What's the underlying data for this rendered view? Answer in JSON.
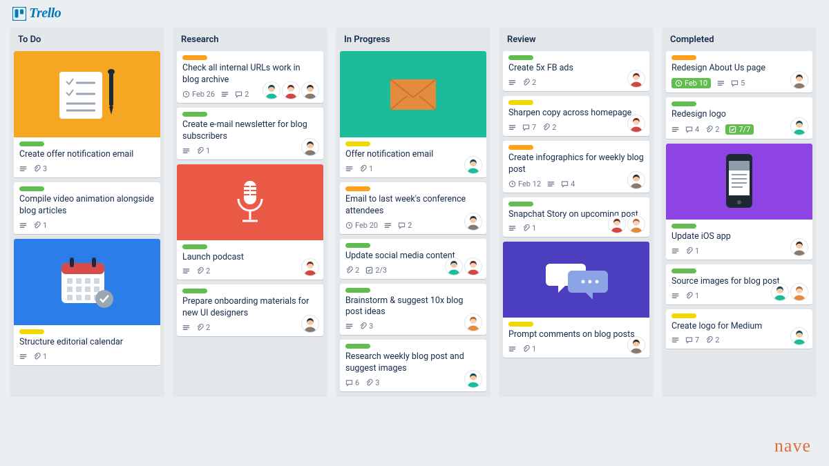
{
  "app": {
    "name": "Trello"
  },
  "brand": "nave",
  "avatars": {
    "teal": "#1abc9c",
    "brown": "#7a5c4b",
    "red": "#d0483f",
    "orange": "#e48b3e"
  },
  "icons": {
    "description": "description-icon",
    "attachment": "attachment-icon",
    "clock": "clock-icon",
    "comment": "comment-icon",
    "checklist": "checklist-icon"
  },
  "lists": [
    {
      "title": "To Do",
      "cards": [
        {
          "cover": "orange-note",
          "labels": [
            "green"
          ],
          "title": "Create offer notification email",
          "badges": {
            "description": true,
            "attachments": 3
          }
        },
        {
          "labels": [
            "green"
          ],
          "title": "Compile video animation alongside blog articles",
          "badges": {
            "description": true,
            "attachments": 1
          }
        },
        {
          "cover": "blue-calendar",
          "labels": [
            "yellow"
          ],
          "title": "Structure editorial calendar",
          "badges": {
            "description": true,
            "attachments": 1
          }
        }
      ]
    },
    {
      "title": "Research",
      "cards": [
        {
          "labels": [
            "orange"
          ],
          "title": "Check all internal URLs work in blog archive",
          "badges": {
            "due": "Feb 26",
            "description": true,
            "comments": 2
          },
          "members": [
            "teal",
            "red",
            "brown"
          ]
        },
        {
          "labels": [
            "green"
          ],
          "title": "Create e-mail newsletter for blog subscribers",
          "badges": {
            "description": true,
            "attachments": 1
          },
          "members": [
            "brown"
          ]
        },
        {
          "cover": "red-mic",
          "labels": [
            "green"
          ],
          "title": "Launch podcast",
          "badges": {
            "description": true,
            "attachments": 2
          },
          "members": [
            "red"
          ]
        },
        {
          "labels": [
            "green"
          ],
          "title": "Prepare onboarding materials for new UI designers",
          "badges": {
            "description": true,
            "attachments": 2
          },
          "members": [
            "brown"
          ]
        }
      ]
    },
    {
      "title": "In Progress",
      "cards": [
        {
          "cover": "teal-mail",
          "labels": [
            "yellow"
          ],
          "title": "Offer notification email",
          "badges": {
            "description": true,
            "attachments": 1
          },
          "members": [
            "teal"
          ]
        },
        {
          "labels": [
            "orange"
          ],
          "title": "Email to last week's conference attendees",
          "badges": {
            "due": "Feb 20",
            "description": true,
            "comments": 2
          },
          "members": [
            "brown"
          ]
        },
        {
          "labels": [
            "green"
          ],
          "title": "Update social media content",
          "badges": {
            "attachments": 2,
            "checklist": "2/3"
          },
          "members": [
            "teal",
            "red"
          ]
        },
        {
          "labels": [
            "green"
          ],
          "title": "Brainstorm & suggest 10x blog post ideas",
          "badges": {
            "description": true,
            "attachments": 3
          },
          "members": [
            "orange"
          ]
        },
        {
          "labels": [
            "green"
          ],
          "title": "Research weekly blog post and suggest images",
          "badges": {
            "attachments": 3,
            "comments": 6
          },
          "members": [
            "teal"
          ]
        }
      ]
    },
    {
      "title": "Review",
      "cards": [
        {
          "labels": [
            "green"
          ],
          "title": "Create 5x FB ads",
          "badges": {
            "description": true,
            "attachments": 2
          },
          "members": [
            "red"
          ]
        },
        {
          "labels": [
            "yellow"
          ],
          "title": "Sharpen copy across homepage",
          "badges": {
            "description": true,
            "comments": 7,
            "attachments": 2
          },
          "members": [
            "red"
          ]
        },
        {
          "labels": [
            "orange"
          ],
          "title": "Create infographics for weekly blog post",
          "badges": {
            "due": "Feb 12",
            "description": true,
            "comments": 4
          },
          "members": [
            "brown"
          ]
        },
        {
          "labels": [
            "green"
          ],
          "title": "Snapchat Story on upcoming post",
          "badges": {
            "description": true,
            "attachments": 1
          },
          "members": [
            "red",
            "orange"
          ]
        },
        {
          "cover": "indigo-chat",
          "labels": [
            "yellow"
          ],
          "title": "Prompt comments on blog posts",
          "badges": {
            "description": true,
            "attachments": 1
          },
          "members": [
            "brown"
          ]
        }
      ]
    },
    {
      "title": "Completed",
      "cards": [
        {
          "labels": [
            "orange"
          ],
          "title": "Redesign About Us page",
          "badges": {
            "due": "Feb 10",
            "dueComplete": true,
            "description": true,
            "comments": 5
          },
          "members": [
            "brown"
          ]
        },
        {
          "labels": [
            "green"
          ],
          "title": "Redesign logo",
          "badges": {
            "description": true,
            "comments": 4,
            "attachments": 2,
            "checklist": "7/7",
            "checklistComplete": true
          },
          "members": [
            "teal"
          ]
        },
        {
          "cover": "purple-phone",
          "labels": [
            "green"
          ],
          "title": "Update iOS app",
          "badges": {
            "description": true,
            "attachments": 1
          },
          "members": [
            "brown"
          ]
        },
        {
          "labels": [
            "green"
          ],
          "title": "Source images for blog post",
          "badges": {
            "description": true,
            "attachments": 1
          },
          "members": [
            "teal",
            "orange"
          ]
        },
        {
          "labels": [
            "yellow"
          ],
          "title": "Create logo for Medium",
          "badges": {
            "description": true,
            "comments": 7,
            "attachments": 2
          },
          "members": [
            "teal"
          ]
        }
      ]
    }
  ]
}
